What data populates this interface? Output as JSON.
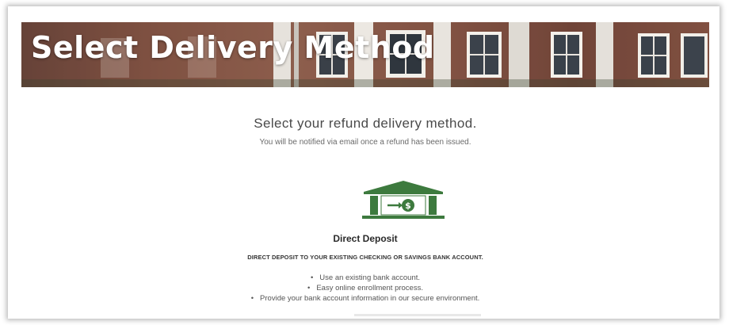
{
  "banner": {
    "title": "Select Delivery Method"
  },
  "main": {
    "heading": "Select your refund delivery method.",
    "subheading": "You will be notified via email once a refund has been issued."
  },
  "option": {
    "icon": "bank-deposit-icon",
    "title": "Direct Deposit",
    "description": "DIRECT DEPOSIT TO YOUR EXISTING CHECKING OR SAVINGS BANK ACCOUNT.",
    "bullets": [
      "Use an existing bank account.",
      "Easy online enrollment process.",
      "Provide your bank account information in our secure environment."
    ]
  },
  "colors": {
    "accent_green": "#3d7a3e",
    "banner_brick": "#8a5a48",
    "text_dark": "#4a4a4a"
  }
}
